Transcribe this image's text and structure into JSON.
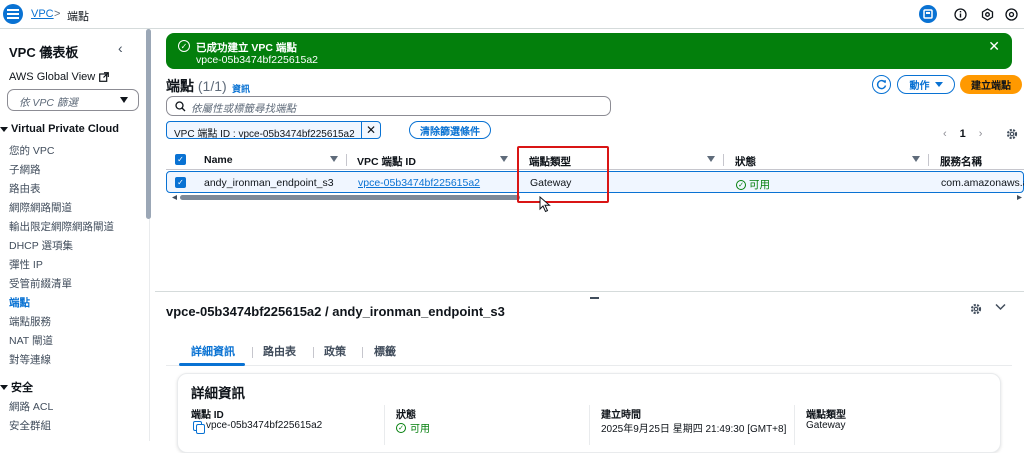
{
  "topbar": {
    "breadcrumb_link": "VPC",
    "breadcrumb_sep": ">",
    "breadcrumb_current": "端點"
  },
  "sidebar": {
    "title": "VPC 儀表板",
    "aws_global_view": "AWS Global View",
    "filter_placeholder": "依 VPC 篩選",
    "section_vpc": "Virtual Private Cloud",
    "items": [
      "您的 VPC",
      "子網路",
      "路由表",
      "網際網路閘道",
      "輸出限定網際網路閘道",
      "DHCP 選項集",
      "彈性 IP",
      "受管前綴清單",
      "端點",
      "端點服務",
      "NAT 閘道",
      "對等連線"
    ],
    "active_item": "端點",
    "section_security": "安全",
    "security_items": [
      "網路 ACL",
      "安全群組"
    ]
  },
  "flash": {
    "title": "已成功建立 VPC 端點",
    "subtitle": "vpce-05b3474bf225615a2",
    "color": "#037f0c"
  },
  "endpoints": {
    "title": "端點",
    "count": "(1/1)",
    "info": "資訊",
    "action_label": "動作",
    "create_label": "建立端點",
    "search_placeholder": "依屬性或標籤尋找端點",
    "filter_chip": "VPC 端點 ID : vpce-05b3474bf225615a2",
    "clear_filters": "清除篩選條件",
    "page": "1",
    "columns": [
      "Name",
      "VPC 端點 ID",
      "端點類型",
      "狀態",
      "服務名稱"
    ],
    "rows": [
      {
        "name": "andy_ironman_endpoint_s3",
        "id": "vpce-05b3474bf225615a2",
        "type": "Gateway",
        "status": "可用",
        "service": "com.amazonaws.ap"
      }
    ]
  },
  "detail": {
    "title": "vpce-05b3474bf225615a2 / andy_ironman_endpoint_s3",
    "tabs": [
      "詳細資訊",
      "路由表",
      "政策",
      "標籤"
    ],
    "active_tab": "詳細資訊",
    "card_title": "詳細資訊",
    "fields": [
      {
        "label": "端點 ID",
        "value": "vpce-05b3474bf225615a2"
      },
      {
        "label": "狀態",
        "value": "可用"
      },
      {
        "label": "建立時間",
        "value": "2025年9月25日 星期四 21:49:30 [GMT+8]"
      },
      {
        "label": "端點類型",
        "value": "Gateway"
      }
    ]
  },
  "colors": {
    "accent": "#0972d3",
    "success": "#037f0c",
    "primary_button": "#ff9900",
    "highlight": "#d91515"
  },
  "icons": [
    "menu-icon",
    "chevron-right-icon",
    "notifications-panel-icon",
    "info-icon",
    "settings-icon",
    "help-icon",
    "external-link-icon",
    "collapse-icon",
    "search-icon",
    "refresh-icon",
    "gear-icon",
    "close-icon",
    "check-circle-icon",
    "copy-icon",
    "chevron-down-icon",
    "cursor-icon"
  ]
}
